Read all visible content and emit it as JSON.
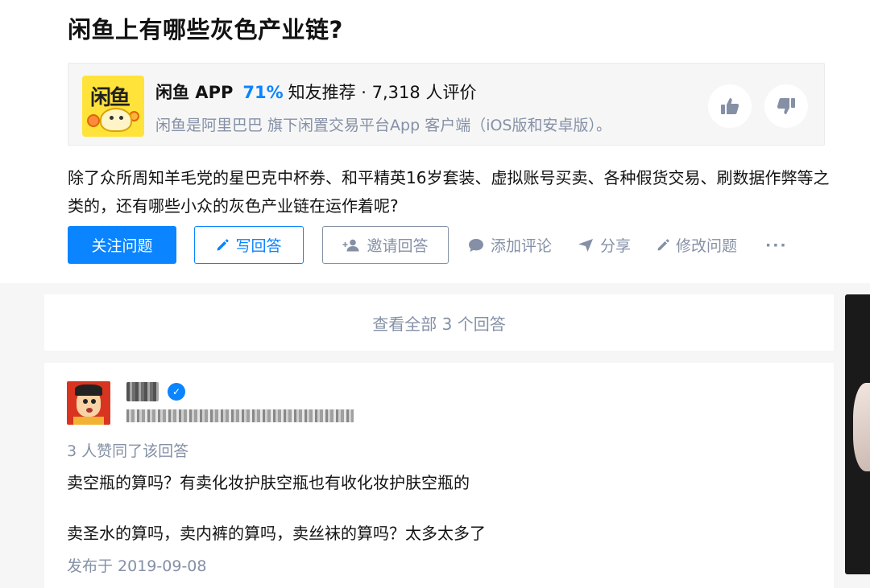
{
  "question": {
    "title": "闲鱼上有哪些灰色产业链?",
    "detail": "除了众所周知羊毛党的星巴克中杯券、和平精英16岁套装、虚拟账号买卖、各种假货交易、刷数据作弊等之类的，还有哪些小众的灰色产业链在运作着呢?"
  },
  "app_card": {
    "logo_text": "闲鱼",
    "name": "闲鱼 APP",
    "percent": "71%",
    "recommend": "知友推荐 · 7,318 人评价",
    "description": "闲鱼是阿里巴巴 旗下闲置交易平台App 客户端（iOS版和安卓版）。",
    "icons": {
      "up": "thumbs-up-icon",
      "down": "thumbs-down-icon"
    }
  },
  "actions": {
    "follow": "关注问题",
    "write": "写回答",
    "invite": "邀请回答",
    "comment": "添加评论",
    "share": "分享",
    "edit": "修改问题",
    "more": "···"
  },
  "view_all": "查看全部 3 个回答",
  "answer": {
    "vote_count": "3 人赞同了该回答",
    "paragraphs": [
      "卖空瓶的算吗？有卖化妆护肤空瓶也有收化妆护肤空瓶的",
      "卖圣水的算吗，卖内裤的算吗，卖丝袜的算吗？太多太多了"
    ],
    "published": "发布于 2019-09-08"
  },
  "colors": {
    "accent": "#0a84ff",
    "muted": "#8590a6",
    "text": "#121212",
    "logo_bg": "#ffe33b"
  }
}
